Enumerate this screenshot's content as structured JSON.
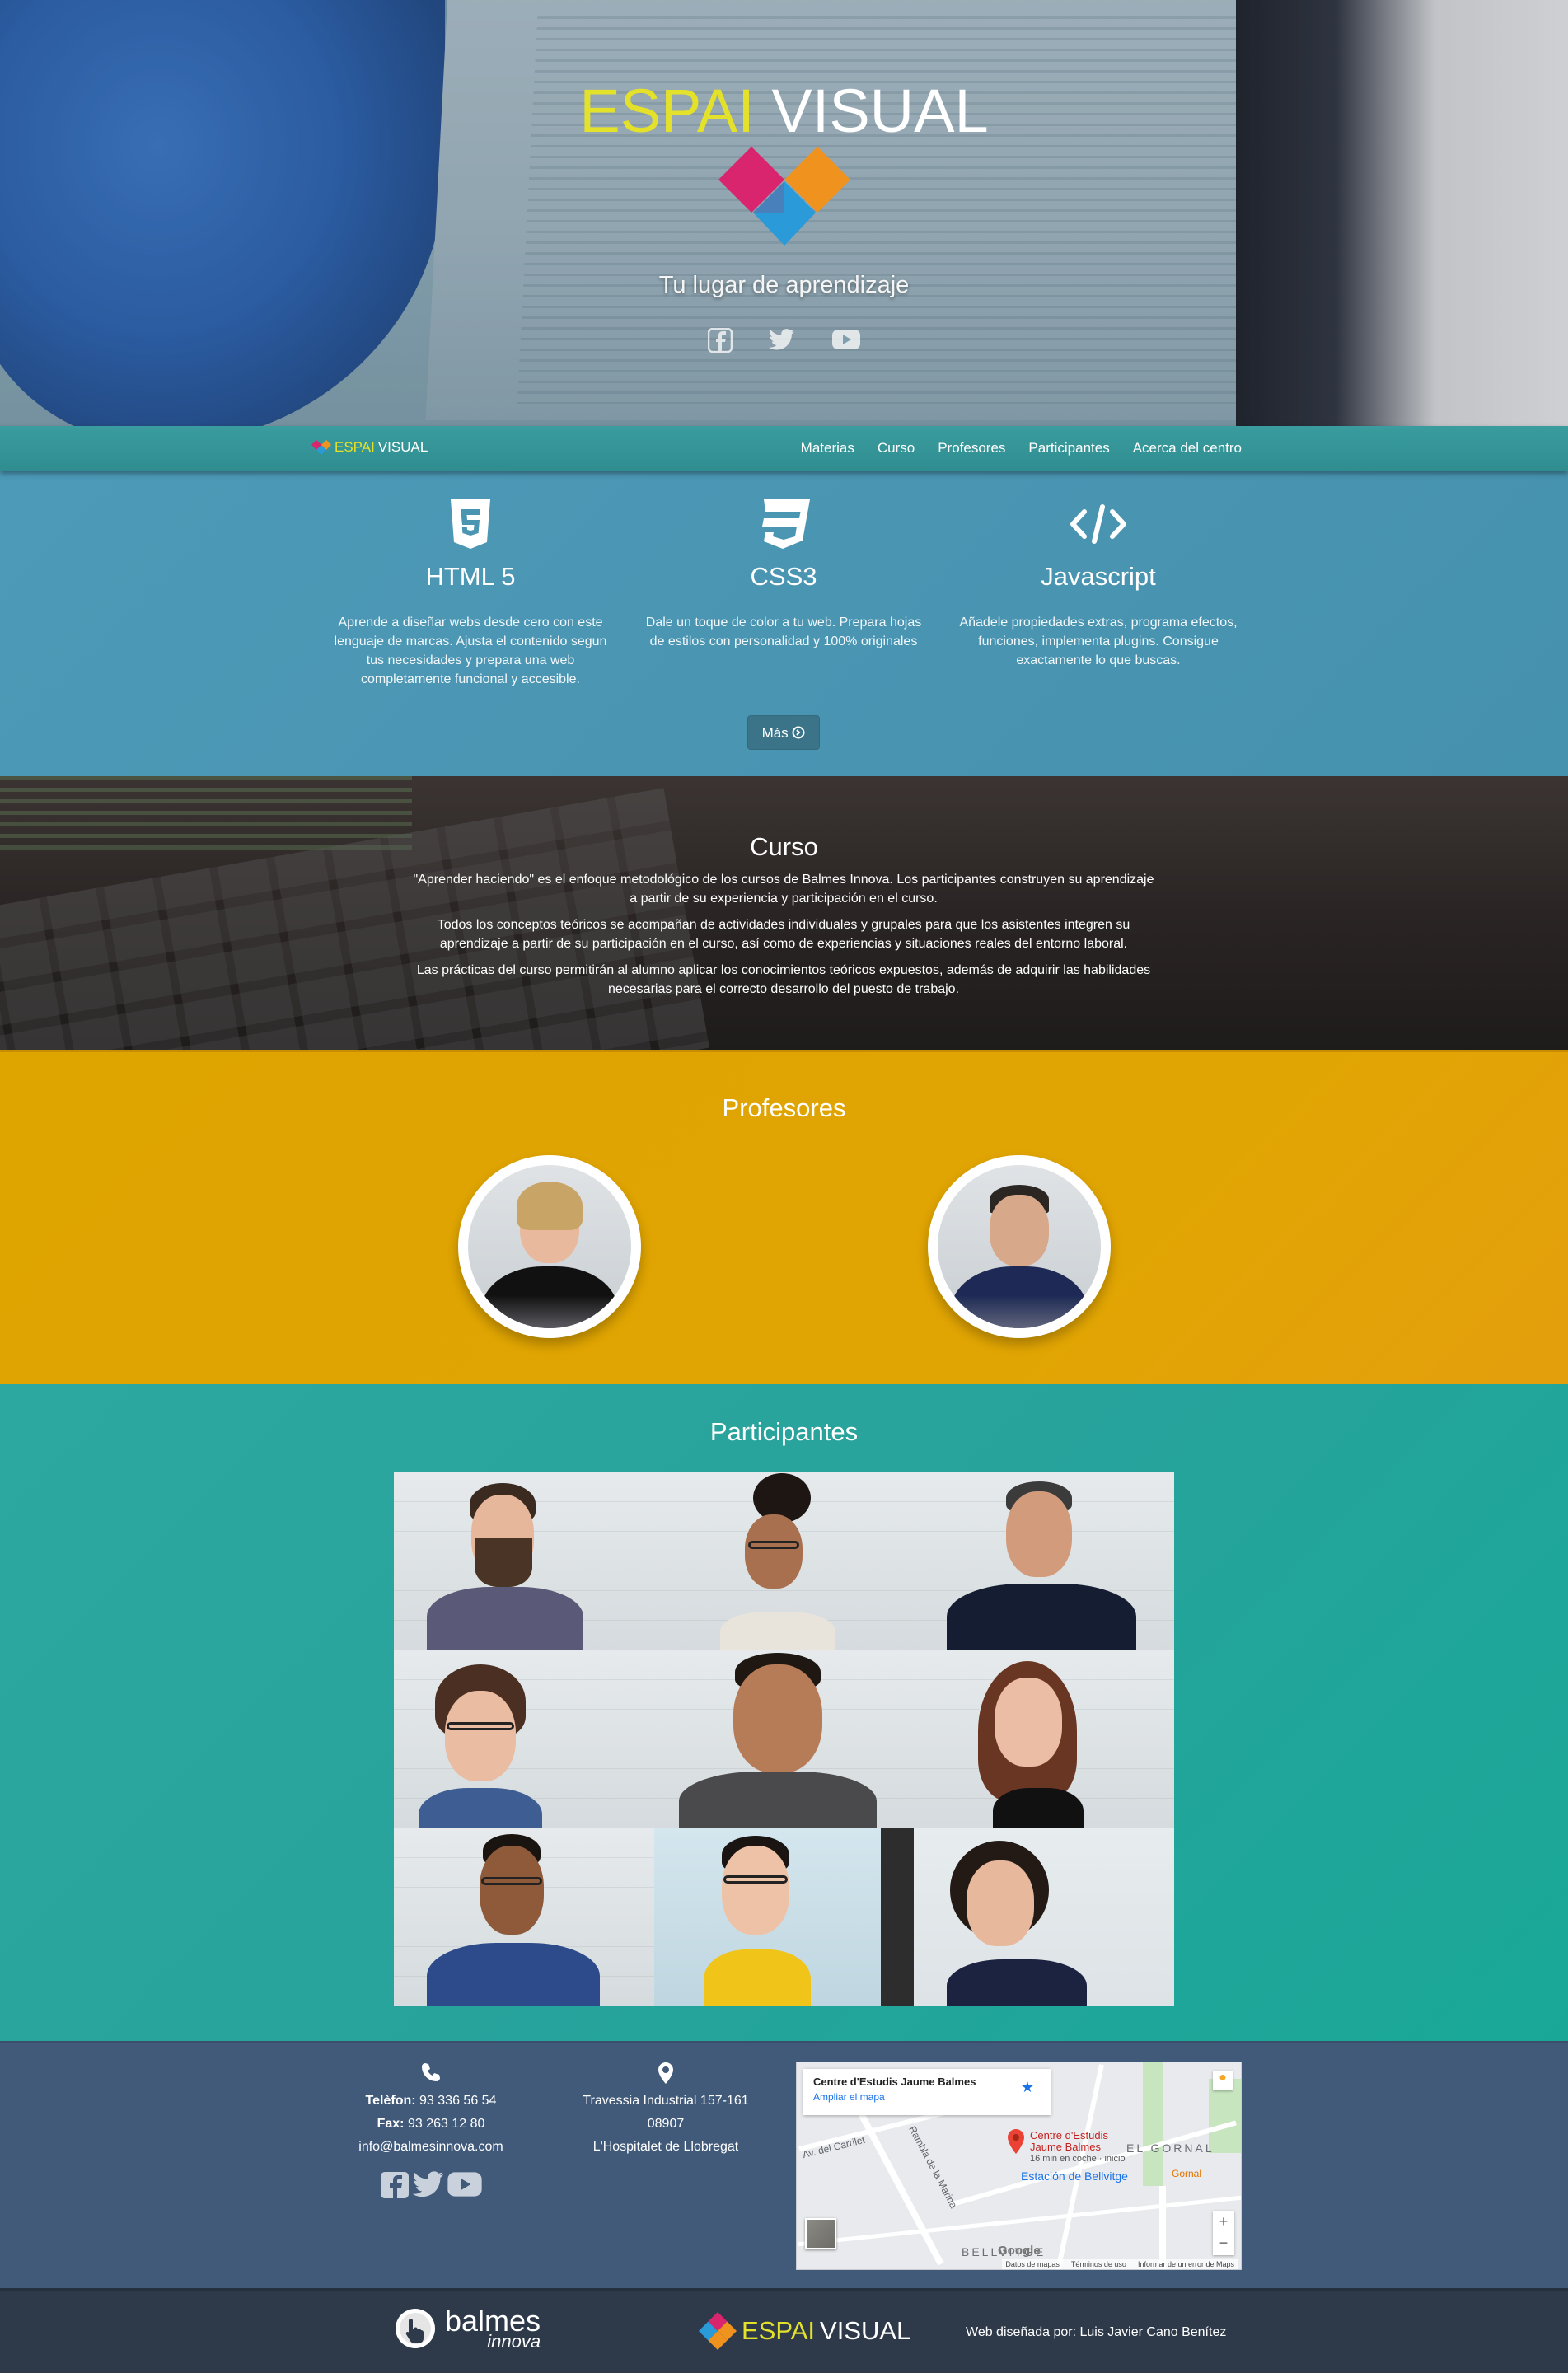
{
  "brand": {
    "part1": "ESPAI",
    "part2": "VISUAL",
    "accent": "#e4e12a"
  },
  "hero": {
    "tagline": "Tu lugar de aprendizaje",
    "social": [
      "facebook-icon",
      "twitter-icon",
      "youtube-icon"
    ]
  },
  "nav": {
    "brand_part1": "ESPAI",
    "brand_part2": "VISUAL",
    "items": [
      "Materias",
      "Curso",
      "Profesores",
      "Participantes",
      "Acerca del centro"
    ]
  },
  "tech": {
    "columns": [
      {
        "icon": "html5-icon",
        "title": "HTML 5",
        "text": "Aprende a diseñar webs desde cero con este lenguaje de marcas. Ajusta el contenido segun tus necesidades y prepara una web completamente funcional y accesible."
      },
      {
        "icon": "css3-icon",
        "title": "CSS3",
        "text": "Dale un toque de color a tu web. Prepara hojas de estilos con personalidad y 100% originales"
      },
      {
        "icon": "code-icon",
        "title": "Javascript",
        "text": "Añadele propiedades extras, programa efectos, funciones, implementa plugins. Consigue exactamente lo que buscas."
      }
    ],
    "more_label": "Más"
  },
  "curso": {
    "title": "Curso",
    "paragraphs": [
      "\"Aprender haciendo\" es el enfoque metodológico de los cursos de Balmes Innova. Los participantes construyen su aprendizaje a partir de su experiencia y participación en el curso.",
      "Todos los conceptos teóricos se acompañan de actividades individuales y grupales para que los asistentes integren su aprendizaje a partir de su participación en el curso, así como de experiencias y situaciones reales del entorno laboral.",
      "Las prácticas del curso permitirán al alumno aplicar los conocimientos teóricos expuestos, además de adquirir las habilidades necesarias para el correcto desarrollo del puesto de trabajo."
    ]
  },
  "profesores": {
    "title": "Profesores"
  },
  "participantes": {
    "title": "Participantes"
  },
  "contact": {
    "phone_label": "Telèfon:",
    "phone": "93 336 56 54",
    "fax_label": "Fax:",
    "fax": "93 263 12 80",
    "email": "info@balmesinnova.com",
    "address1": "Travessia Industrial 157-161",
    "address2": "08907",
    "address3": "L'Hospitalet de Llobregat"
  },
  "map": {
    "place": "Centre d'Estudis Jaume Balmes",
    "enlarge": "Ampliar el mapa",
    "pin_label1": "Centre d'Estudis",
    "pin_label2": "Jaume Balmes",
    "pin_sub": "16 min en coche · inicio",
    "station": "Estación de Bellvitge",
    "area1": "EL GORNAL",
    "area2": "BELLVITGE",
    "street1": "Av. del Carrilet",
    "street2": "Rambla de la Marina",
    "gornal": "Gornal",
    "google": "Google",
    "attrib": [
      "Datos de mapas",
      "Términos de uso",
      "Informar de un error de Maps"
    ]
  },
  "footer": {
    "balmes_name": "balmes",
    "balmes_sub": "innova",
    "brand_part1": "ESPAI",
    "brand_part2": "VISUAL",
    "credit": "Web diseñada por: Luis Javier Cano Benítez"
  }
}
